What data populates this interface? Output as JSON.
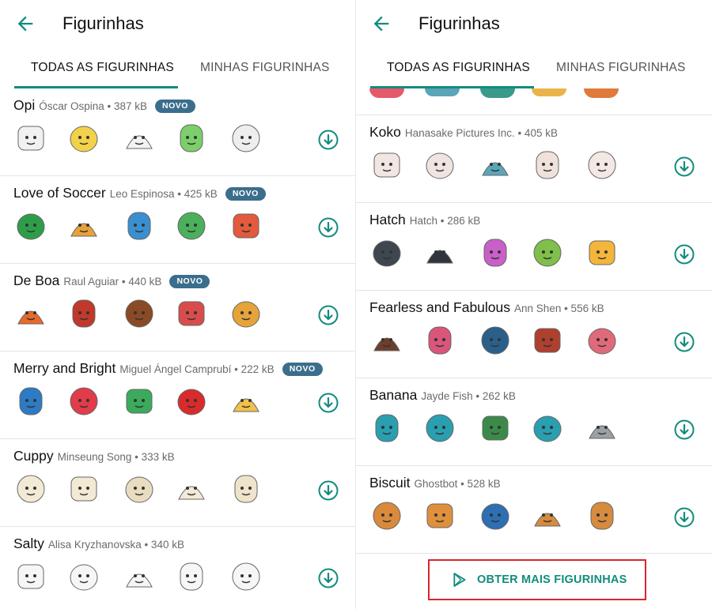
{
  "colors": {
    "accent": "#128c7e",
    "badge": "#3b6e8c",
    "highlight": "#d9262c"
  },
  "left": {
    "title": "Figurinhas",
    "tabs": [
      "TODAS AS FIGURINHAS",
      "MINHAS FIGURINHAS"
    ],
    "packs": [
      {
        "name": "Opi",
        "meta": "Óscar Ospina • 387 kB",
        "badge": "NOVO",
        "palette": [
          "#f1f1f1",
          "#f2d24a",
          "#f3f3f3",
          "#7ccf6a",
          "#eeeeee"
        ]
      },
      {
        "name": "Love of Soccer",
        "meta": "Leo Espinosa • 425 kB",
        "badge": "NOVO",
        "palette": [
          "#2e9d4a",
          "#e8a13a",
          "#3a8fd0",
          "#4bb05c",
          "#e45a3c"
        ]
      },
      {
        "name": "De Boa",
        "meta": "Raul Aguiar • 440 kB",
        "badge": "NOVO",
        "palette": [
          "#e86a2a",
          "#c0392b",
          "#8a4a26",
          "#d94c4c",
          "#e5a33a"
        ]
      },
      {
        "name": "Merry and Bright",
        "meta": "Miguel Ángel Camprubí • 222 kB",
        "badge": "NOVO",
        "palette": [
          "#2d7bc4",
          "#e23b4a",
          "#3caa5c",
          "#d92b2b",
          "#f0c24a"
        ]
      },
      {
        "name": "Cuppy",
        "meta": "Minseung Song • 333 kB",
        "badge": "",
        "palette": [
          "#f3ead6",
          "#f3ead6",
          "#e9dcc0",
          "#f3ead6",
          "#efe3cb"
        ]
      },
      {
        "name": "Salty",
        "meta": "Alisa Kryzhanovska • 340 kB",
        "badge": "",
        "palette": [
          "#f6f6f6",
          "#f6f6f6",
          "#f6f6f6",
          "#f6f6f6",
          "#f6f6f6"
        ]
      }
    ]
  },
  "right": {
    "title": "Figurinhas",
    "tabs": [
      "TODAS AS FIGURINHAS",
      "MINHAS FIGURINHAS"
    ],
    "packs": [
      {
        "name": "Koko",
        "meta": "Hanasake Pictures Inc. • 405 kB",
        "badge": "",
        "palette": [
          "#f2e6e2",
          "#efe4df",
          "#5aa6b8",
          "#f0e1dc",
          "#f3e8e4"
        ]
      },
      {
        "name": "Hatch",
        "meta": "Hatch • 286 kB",
        "badge": "",
        "palette": [
          "#3e4650",
          "#2f353d",
          "#c95fc8",
          "#7fbf4a",
          "#f3b63a"
        ]
      },
      {
        "name": "Fearless and Fabulous",
        "meta": "Ann Shen • 556 kB",
        "badge": "",
        "palette": [
          "#6b3f2a",
          "#d9567a",
          "#2a5f8a",
          "#b0402e",
          "#e06a7a"
        ]
      },
      {
        "name": "Banana",
        "meta": "Jayde Fish • 262 kB",
        "badge": "",
        "palette": [
          "#2a9fb0",
          "#2a9fb0",
          "#3c8a4a",
          "#2a9fb0",
          "#9aa0a6"
        ]
      },
      {
        "name": "Biscuit",
        "meta": "Ghostbot • 528 kB",
        "badge": "",
        "palette": [
          "#d98a3a",
          "#e0903c",
          "#2c6fb3",
          "#d78b3e",
          "#d78b3e"
        ]
      }
    ],
    "more_label": "OBTER MAIS FIGURINHAS"
  }
}
